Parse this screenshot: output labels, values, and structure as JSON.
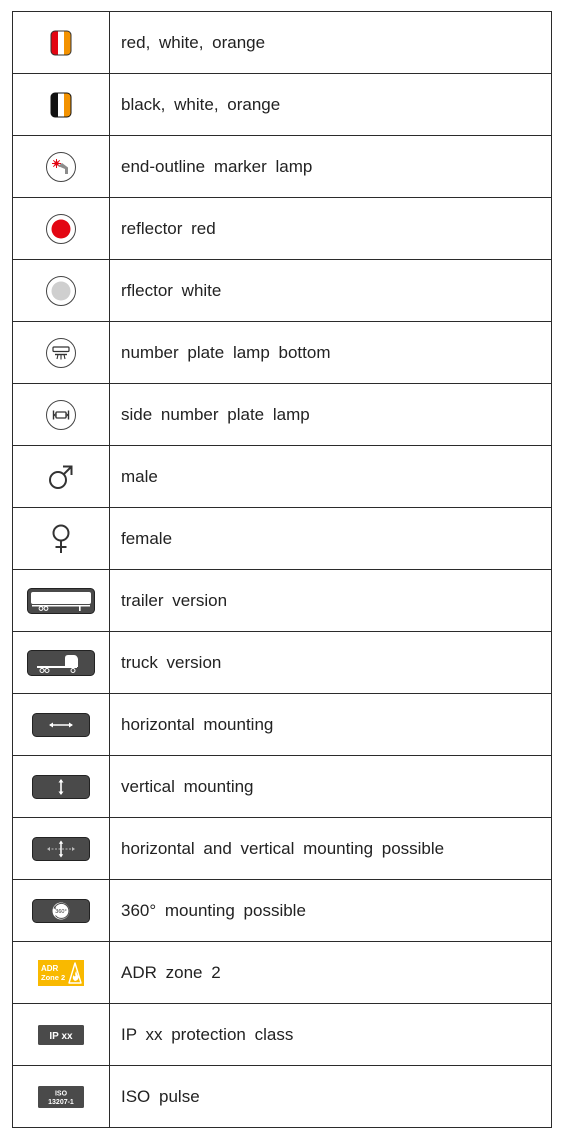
{
  "rows": [
    {
      "icon": "red-white-orange-swatch-icon",
      "label": "red, white, orange"
    },
    {
      "icon": "black-white-orange-swatch-icon",
      "label": "black, white, orange"
    },
    {
      "icon": "end-outline-marker-lamp-icon",
      "label": "end-outline marker lamp"
    },
    {
      "icon": "reflector-red-icon",
      "label": "reflector red"
    },
    {
      "icon": "reflector-white-icon",
      "label": "rflector white"
    },
    {
      "icon": "number-plate-lamp-bottom-icon",
      "label": "number plate lamp bottom"
    },
    {
      "icon": "side-number-plate-lamp-icon",
      "label": "side number plate lamp"
    },
    {
      "icon": "male-symbol-icon",
      "label": "male"
    },
    {
      "icon": "female-symbol-icon",
      "label": "female"
    },
    {
      "icon": "trailer-icon",
      "label": "trailer version"
    },
    {
      "icon": "truck-icon",
      "label": "truck version"
    },
    {
      "icon": "horizontal-arrow-icon",
      "label": "horizontal mounting"
    },
    {
      "icon": "vertical-arrow-icon",
      "label": "vertical mounting"
    },
    {
      "icon": "four-way-arrow-icon",
      "label": "horizontal and vertical mounting possible"
    },
    {
      "icon": "rotation-360-icon",
      "label": "360° mounting possible"
    },
    {
      "icon": "adr-zone-2-icon",
      "label": "ADR zone 2"
    },
    {
      "icon": "ip-class-icon",
      "label": "IP xx protection class"
    },
    {
      "icon": "iso-pulse-icon",
      "label": "ISO pulse"
    }
  ],
  "icon_text": {
    "rotation": "360°",
    "adr_line1": "ADR",
    "adr_line2": "Zone 2",
    "ip": "IP xx",
    "iso_line1": "ISO",
    "iso_line2": "13207-1"
  },
  "colors": {
    "red": "#e30613",
    "orange": "#f39200",
    "dark_gray": "#4a4a4a",
    "light_gray": "#c8c8c8",
    "adr_yellow": "#f9b900"
  }
}
